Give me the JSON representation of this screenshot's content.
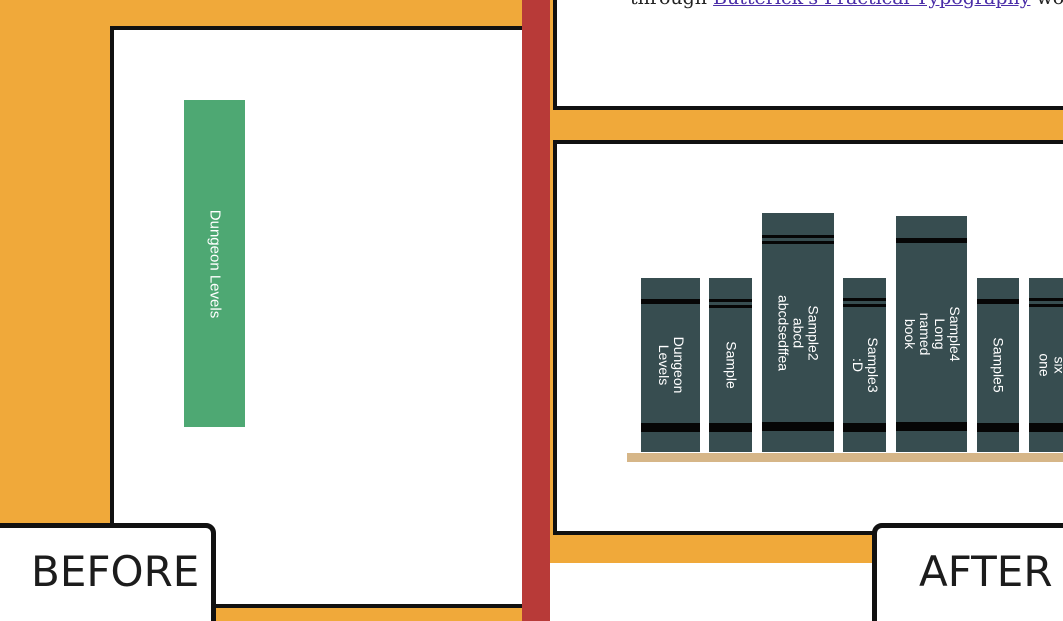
{
  "labels": {
    "before": "BEFORE",
    "after": "AFTER"
  },
  "before": {
    "book_label": "Dungeon Levels"
  },
  "after_top": {
    "text_before_link": "through ",
    "link_text": "Butterick's Practical Typography",
    "text_after_link": " wo"
  },
  "shelf": {
    "books": [
      {
        "title": "Dungeon\nLevels"
      },
      {
        "title": "Sample"
      },
      {
        "title": "Sample2 abcd\nabcdsedffea"
      },
      {
        "title": "Sample3 :D"
      },
      {
        "title": "Sample4 Long\nnamed book"
      },
      {
        "title": "Sample5"
      },
      {
        "title": "Sample six\none"
      }
    ]
  },
  "colors": {
    "background": "#f0a93a",
    "divider": "#b83a38",
    "before_book": "#4ea873",
    "book_spine": "#374d50",
    "shelf": "#d6b688"
  }
}
